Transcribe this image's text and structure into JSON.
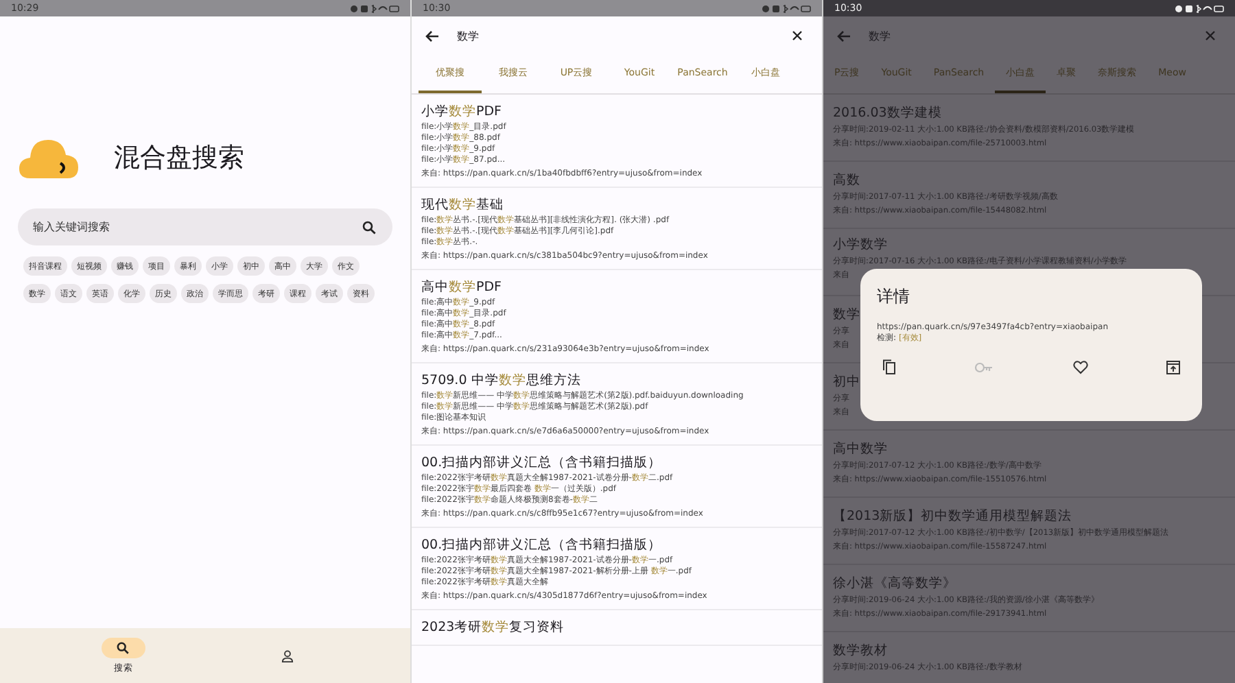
{
  "home": {
    "status_time": "10:29",
    "app_title": "混合盘搜索",
    "search": {
      "placeholder": "输入关键词搜索"
    },
    "tags": [
      "抖音课程",
      "短视频",
      "赚钱",
      "项目",
      "暴利",
      "小学",
      "初中",
      "高中",
      "大学",
      "作文",
      "数学",
      "语文",
      "英语",
      "化学",
      "历史",
      "政治",
      "学而思",
      "考研",
      "课程",
      "考试",
      "资料"
    ],
    "nav": [
      {
        "kind": "search",
        "label": "搜索",
        "selected": true
      },
      {
        "kind": "profile",
        "selected": false
      }
    ]
  },
  "results": {
    "status_time": "10:30",
    "query": "数学",
    "tabs": [
      {
        "label": "优聚搜",
        "selected": true
      },
      {
        "label": "我搜云",
        "selected": false
      },
      {
        "label": "UP云搜",
        "selected": false
      },
      {
        "label": "YouGit",
        "selected": false
      },
      {
        "label": "PanSearch",
        "selected": false
      },
      {
        "label": "小白盘",
        "selected": false
      }
    ],
    "items": [
      {
        "title": "小学**数学**PDF",
        "files": [
          "file:小学**数学**_目录.pdf",
          "file:小学**数学**_88.pdf",
          "file:小学**数学**_9.pdf",
          "file:小学**数学**_87.pd..."
        ],
        "source": "来自: https://pan.quark.cn/s/1ba40fbdbff6?entry=ujuso&from=index"
      },
      {
        "title": "现代**数学**基础",
        "files": [
          "file:**数学**丛书.-.[现代**数学**基础丛书][非线性演化方程]. (张大潜) .pdf",
          "file:**数学**丛书.-.[现代**数学**基础丛书][李几何引论].pdf",
          "file:**数学**丛书.-."
        ],
        "source": "来自: https://pan.quark.cn/s/c381ba504bc9?entry=ujuso&from=index"
      },
      {
        "title": "高中**数学**PDF",
        "files": [
          "file:高中**数学**_9.pdf",
          "file:高中**数学**_目录.pdf",
          "file:高中**数学**_8.pdf",
          "file:高中**数学**_7.pdf..."
        ],
        "source": "来自: https://pan.quark.cn/s/231a93064e3b?entry=ujuso&from=index"
      },
      {
        "title": "5709.0 中学**数学**思维方法",
        "files": [
          "file:**数学**新思维—— 中学**数学**思维策略与解题艺术(第2版).pdf.baiduyun.downloading",
          "file:**数学**新思维—— 中学**数学**思维策略与解题艺术(第2版).pdf",
          "file:图论基本知识"
        ],
        "source": "来自: https://pan.quark.cn/s/e7d6a6a50000?entry=ujuso&from=index"
      },
      {
        "title": "00.扫描内部讲义汇总（含书籍扫描版）",
        "files": [
          "file:2022张宇考研**数学**真题大全解1987-2021-试卷分册-**数学**二.pdf",
          "file:2022张宇**数学**最后四套卷 **数学**一（过关版）.pdf",
          "file:2022张宇**数学**命题人终极预测8套卷-**数学**二"
        ],
        "source": "来自: https://pan.quark.cn/s/c8ffb95e1c67?entry=ujuso&from=index"
      },
      {
        "title": "00.扫描内部讲义汇总（含书籍扫描版）",
        "files": [
          "file:2022张宇考研**数学**真题大全解1987-2021-试卷分册-**数学**一.pdf",
          "file:2022张宇考研**数学**真题大全解1987-2021-解析分册-上册 **数学**一.pdf",
          "file:2022张宇考研**数学**真题大全解"
        ],
        "source": "来自: https://pan.quark.cn/s/4305d1877d6f?entry=ujuso&from=index"
      },
      {
        "title": "2023考研**数学**复习资料"
      }
    ]
  },
  "detail_screen": {
    "status_time": "10:30",
    "query": "数学",
    "tabs": [
      {
        "label": "P云搜",
        "selected": false
      },
      {
        "label": "YouGit",
        "selected": false
      },
      {
        "label": "PanSearch",
        "selected": false
      },
      {
        "label": "小白盘",
        "selected": true
      },
      {
        "label": "卓聚",
        "selected": false
      },
      {
        "label": "奈斯搜索",
        "selected": false
      },
      {
        "label": "Meow",
        "selected": false
      }
    ],
    "items": [
      {
        "title": "2016.03数学建模",
        "meta": "分享时间:2019-02-11 大小:1.00 KB路径:/协会资料/数模部资料/2016.03数学建模",
        "source": "来自: https://www.xiaobaipan.com/file-25710003.html"
      },
      {
        "title": "高数",
        "meta": "分享时间:2017-07-11 大小:1.00 KB路径:/考研数学视频/高数",
        "source": "来自: https://www.xiaobaipan.com/file-15448082.html"
      },
      {
        "title": "小学数学",
        "meta": "分享时间:2017-07-16 大小:1.00 KB路径:/电子资料/小学课程教辅资料/小学数学",
        "source": "来自"
      },
      {
        "title": "数学",
        "meta": "分享",
        "source": "来自"
      },
      {
        "title": "初中",
        "meta": "分享",
        "source": "来自"
      },
      {
        "title": "高中数学",
        "meta": "分享时间:2017-07-12 大小:1.00 KB路径:/数学/高中数学",
        "source": "来自: https://www.xiaobaipan.com/file-15510576.html"
      },
      {
        "title": "【2013新版】初中数学通用模型解题法",
        "meta": "分享时间:2017-07-12 大小:1.00 KB路径:/初中数学/【2013新版】初中数学通用模型解题法",
        "source": "来自: https://www.xiaobaipan.com/file-15587247.html"
      },
      {
        "title": "徐小湛《高等数学》",
        "meta": "分享时间:2019-06-24 大小:1.00 KB路径:/我的资源/徐小湛《高等数学》",
        "source": "来自: https://www.xiaobaipan.com/file-29173941.html"
      },
      {
        "title": "数学教材",
        "meta": "分享时间:2019-06-24 大小:1.00 KB路径:/数学教材"
      }
    ],
    "dialog": {
      "title": "详情",
      "url": "https://pan.quark.cn/s/97e3497fa4cb?entry=xiaobaipan",
      "check": "检测: **[有效]**",
      "actions": [
        {
          "kind": "copy",
          "disabled": false
        },
        {
          "kind": "key",
          "disabled": true
        },
        {
          "kind": "favorite",
          "disabled": false
        },
        {
          "kind": "open",
          "disabled": false
        }
      ]
    }
  }
}
